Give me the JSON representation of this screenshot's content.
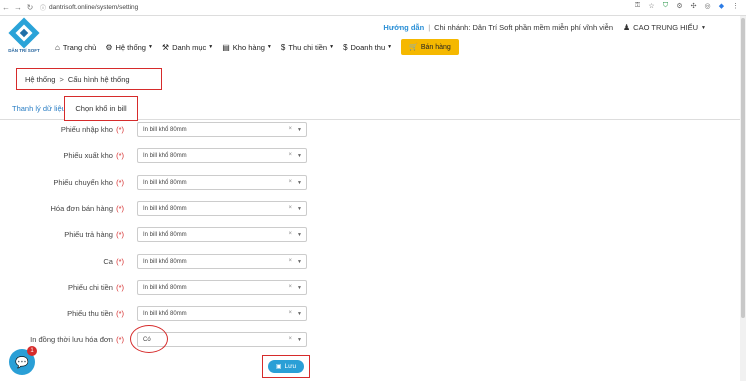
{
  "browser": {
    "url": "dantrisoft.online/system/setting"
  },
  "header": {
    "logo_text": "DÂN TRÍ SOFT",
    "guide": "Hướng dẫn",
    "separator": "|",
    "branch": "Chi nhánh: Dân Trí Soft phần mềm miễn phí vĩnh viễn",
    "user": "CAO TRUNG HIẾU"
  },
  "menu": {
    "items": [
      {
        "label": "Trang chủ",
        "icon": "home-icon",
        "dropdown": false
      },
      {
        "label": "Hệ thống",
        "icon": "gear-icon",
        "dropdown": true
      },
      {
        "label": "Danh mục",
        "icon": "wrench-icon",
        "dropdown": true
      },
      {
        "label": "Kho hàng",
        "icon": "warehouse-icon",
        "dropdown": true
      },
      {
        "label": "Thu chi tiền",
        "icon": "dollar-icon",
        "dropdown": true
      },
      {
        "label": "Doanh thu",
        "icon": "dollar-icon",
        "dropdown": true
      }
    ],
    "sell_button": "Bán hàng"
  },
  "breadcrumb": {
    "root": "Hệ thống",
    "sep": ">",
    "current": "Cấu hình hệ thống"
  },
  "tabs": [
    {
      "label": "Thanh lý dữ liệu",
      "active": false
    },
    {
      "label": "Chọn khổ in bill",
      "active": true
    }
  ],
  "form": {
    "required_mark": "(*)",
    "rows": [
      {
        "label": "Phiếu nhập kho",
        "value": "In bill khổ 80mm"
      },
      {
        "label": "Phiếu xuất kho",
        "value": "In bill khổ 80mm"
      },
      {
        "label": "Phiếu chuyển kho",
        "value": "In bill khổ 80mm"
      },
      {
        "label": "Hóa đơn bán hàng",
        "value": "In bill khổ 80mm"
      },
      {
        "label": "Phiếu trả hàng",
        "value": "In bill khổ 80mm"
      },
      {
        "label": "Ca",
        "value": "In bill khổ 80mm"
      },
      {
        "label": "Phiếu chi tiền",
        "value": "In bill khổ 80mm"
      },
      {
        "label": "Phiếu thu tiền",
        "value": "In bill khổ 80mm"
      },
      {
        "label": "In đồng thời lưu hóa đơn",
        "value": "Có"
      }
    ],
    "clear_glyph": "×",
    "save_label": "Lưu"
  },
  "chat": {
    "badge": "1"
  },
  "colors": {
    "accent": "#2a9fd6",
    "highlight": "#d62b2b",
    "sell_button": "#f5b800"
  }
}
